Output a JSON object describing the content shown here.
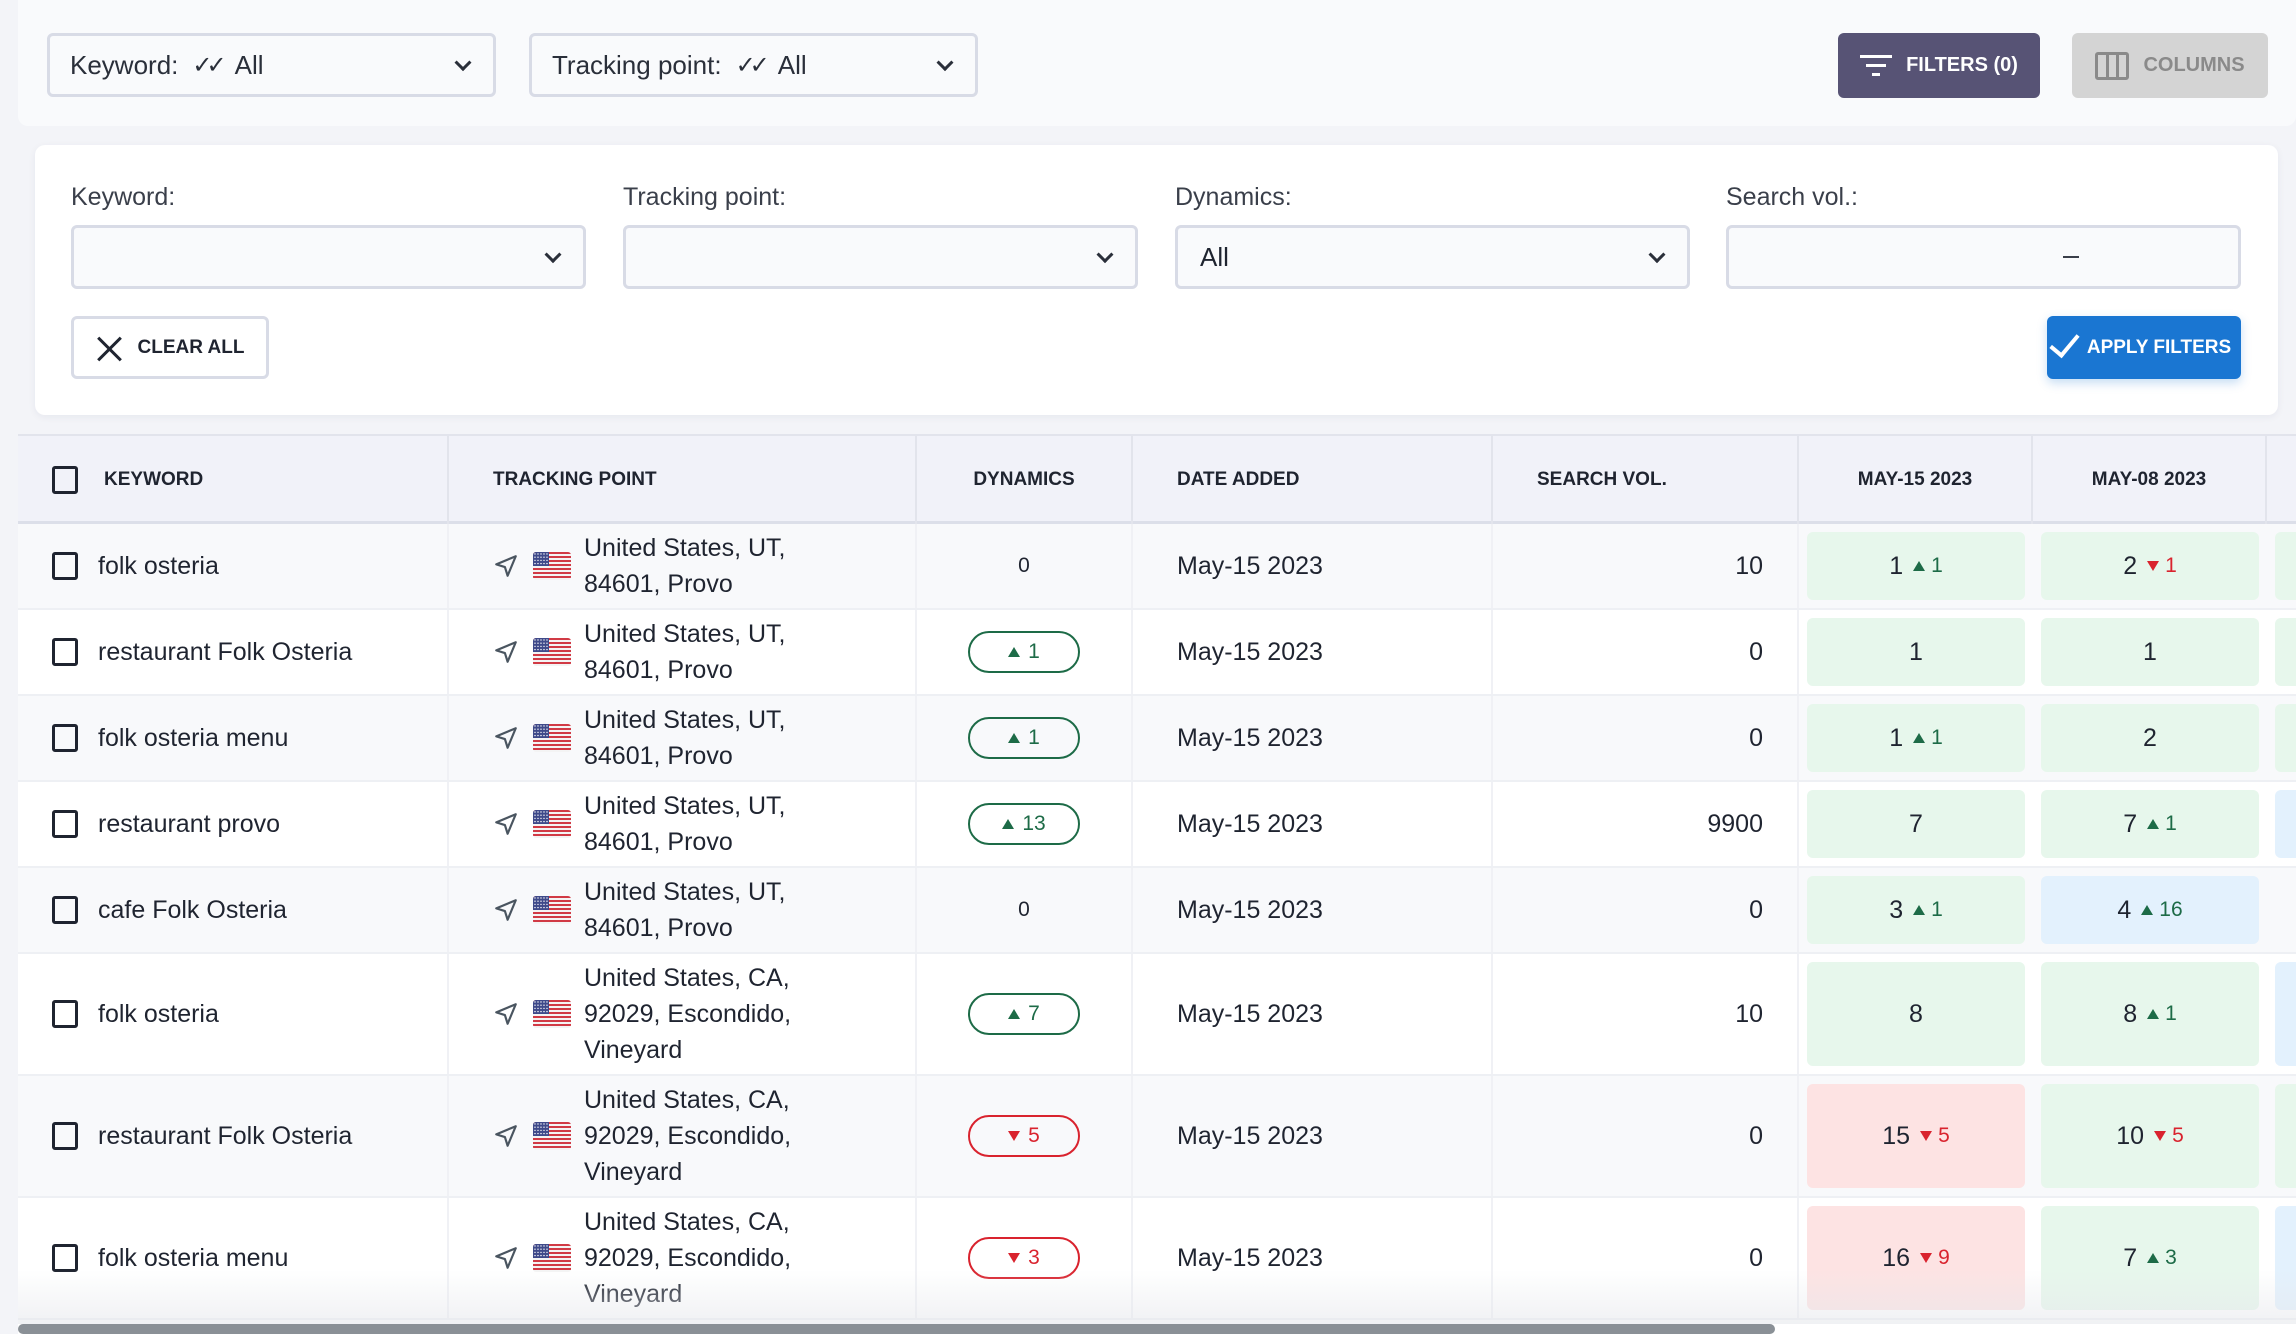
{
  "toolbar": {
    "keyword_filter": {
      "label": "Keyword:",
      "value": "All"
    },
    "tracking_point_filter": {
      "label": "Tracking point:",
      "value": "All"
    },
    "filters_button": "FILTERS (0)",
    "columns_button": "COLUMNS"
  },
  "filter_panel": {
    "keyword": {
      "label": "Keyword:",
      "value": ""
    },
    "tracking_point": {
      "label": "Tracking point:",
      "value": ""
    },
    "dynamics": {
      "label": "Dynamics:",
      "value": "All"
    },
    "search_vol": {
      "label": "Search vol.:",
      "min": "",
      "max": "",
      "separator": "–"
    },
    "clear_all": "CLEAR ALL",
    "apply_filters": "APPLY FILTERS"
  },
  "table": {
    "columns": [
      "KEYWORD",
      "TRACKING POINT",
      "DYNAMICS",
      "DATE ADDED",
      "SEARCH VOL.",
      "MAY-15 2023",
      "MAY-08 2023"
    ],
    "rows": [
      {
        "keyword": "folk osteria",
        "location": [
          "United States, UT,",
          "84601, Provo"
        ],
        "dynamics": {
          "value": "0",
          "dir": "none"
        },
        "date_added": "May-15 2023",
        "search_vol": "10",
        "positions": [
          {
            "pos": "1",
            "change": "1",
            "dir": "up",
            "color": "green"
          },
          {
            "pos": "2",
            "change": "1",
            "dir": "down",
            "color": "green"
          },
          {
            "color": "green"
          }
        ]
      },
      {
        "keyword": "restaurant Folk Osteria",
        "location": [
          "United States, UT,",
          "84601, Provo"
        ],
        "dynamics": {
          "value": "1",
          "dir": "up"
        },
        "date_added": "May-15 2023",
        "search_vol": "0",
        "positions": [
          {
            "pos": "1",
            "change": "",
            "dir": "none",
            "color": "green"
          },
          {
            "pos": "1",
            "change": "",
            "dir": "none",
            "color": "green"
          },
          {
            "color": "green"
          }
        ]
      },
      {
        "keyword": "folk osteria menu",
        "location": [
          "United States, UT,",
          "84601, Provo"
        ],
        "dynamics": {
          "value": "1",
          "dir": "up"
        },
        "date_added": "May-15 2023",
        "search_vol": "0",
        "positions": [
          {
            "pos": "1",
            "change": "1",
            "dir": "up",
            "color": "green"
          },
          {
            "pos": "2",
            "change": "",
            "dir": "none",
            "color": "green"
          },
          {
            "color": "green"
          }
        ]
      },
      {
        "keyword": "restaurant provo",
        "location": [
          "United States, UT,",
          "84601, Provo"
        ],
        "dynamics": {
          "value": "13",
          "dir": "up"
        },
        "date_added": "May-15 2023",
        "search_vol": "9900",
        "positions": [
          {
            "pos": "7",
            "change": "",
            "dir": "none",
            "color": "green"
          },
          {
            "pos": "7",
            "change": "1",
            "dir": "up",
            "color": "green"
          },
          {
            "color": "blue"
          }
        ]
      },
      {
        "keyword": "cafe Folk Osteria",
        "location": [
          "United States, UT,",
          "84601, Provo"
        ],
        "dynamics": {
          "value": "0",
          "dir": "none"
        },
        "date_added": "May-15 2023",
        "search_vol": "0",
        "positions": [
          {
            "pos": "3",
            "change": "1",
            "dir": "up",
            "color": "green"
          },
          {
            "pos": "4",
            "change": "16",
            "dir": "up",
            "color": "blue"
          },
          {
            "color": "none"
          }
        ]
      },
      {
        "keyword": "folk osteria",
        "location": [
          "United States, CA,",
          "92029, Escondido,",
          "Vineyard"
        ],
        "dynamics": {
          "value": "7",
          "dir": "up"
        },
        "date_added": "May-15 2023",
        "search_vol": "10",
        "positions": [
          {
            "pos": "8",
            "change": "",
            "dir": "none",
            "color": "green"
          },
          {
            "pos": "8",
            "change": "1",
            "dir": "up",
            "color": "green"
          },
          {
            "color": "blue"
          }
        ]
      },
      {
        "keyword": "restaurant Folk Osteria",
        "location": [
          "United States, CA,",
          "92029, Escondido,",
          "Vineyard"
        ],
        "dynamics": {
          "value": "5",
          "dir": "down"
        },
        "date_added": "May-15 2023",
        "search_vol": "0",
        "positions": [
          {
            "pos": "15",
            "change": "5",
            "dir": "down",
            "color": "red"
          },
          {
            "pos": "10",
            "change": "5",
            "dir": "down",
            "color": "green"
          },
          {
            "color": "green"
          }
        ]
      },
      {
        "keyword": "folk osteria menu",
        "location": [
          "United States, CA,",
          "92029, Escondido,",
          "Vineyard"
        ],
        "dynamics": {
          "value": "3",
          "dir": "down"
        },
        "date_added": "May-15 2023",
        "search_vol": "0",
        "positions": [
          {
            "pos": "16",
            "change": "9",
            "dir": "down",
            "color": "red"
          },
          {
            "pos": "7",
            "change": "3",
            "dir": "up",
            "color": "green"
          },
          {
            "color": "blue"
          }
        ]
      }
    ]
  },
  "colors": {
    "filters_button": "#575375",
    "apply_button": "#1a76d2",
    "up": "#1d6b47",
    "down": "#d9232e",
    "cell_green": "#e7f7ec",
    "cell_blue": "#e3f1fd",
    "cell_red": "#fde3e3"
  }
}
